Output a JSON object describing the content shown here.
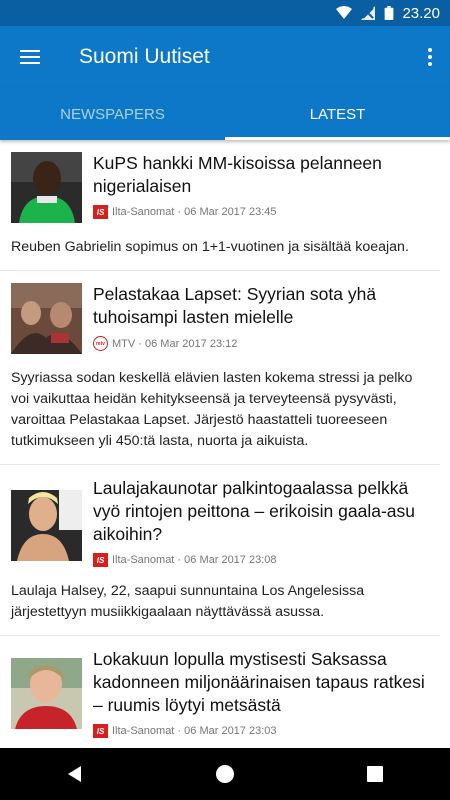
{
  "statusbar": {
    "time": "23.20"
  },
  "appbar": {
    "title": "Suomi Uutiset"
  },
  "tabs": [
    {
      "label": "NEWSPAPERS",
      "active": false
    },
    {
      "label": "LATEST",
      "active": true
    }
  ],
  "articles": [
    {
      "headline": "KuPS hankki MM-kisoissa pelanneen nigerialaisen",
      "source": "Ilta-Sanomat",
      "date": "06 Mar 2017 23:45",
      "summary": "Reuben Gabrielin sopimus on 1+1-vuotinen ja sisältää koeajan.",
      "source_icon": "is-logo-icon"
    },
    {
      "headline": "Pelastakaa Lapset: Syyrian sota yhä tuhoisampi lasten mielelle",
      "source": "MTV",
      "date": "06 Mar 2017 23:12",
      "summary": "Syyriassa sodan keskellä elävien lasten kokema stressi ja pelko voi vaikuttaa heidän kehitykseensä ja terveyteensä pysyvästi, varoittaa Pelastakaa Lapset. Järjestö haastatteli tuoreeseen tutkimukseen yli 450:tä lasta, nuorta ja aikuista.",
      "source_icon": "mtv-logo-icon"
    },
    {
      "headline": "Laulajakaunotar palkintogaalassa pelkkä vyö rintojen peittona – erikoisin gaala-asu aikoihin?",
      "source": "Ilta-Sanomat",
      "date": "06 Mar 2017 23:08",
      "summary": "Laulaja Halsey, 22, saapui sunnuntaina Los Angelesissa järjestettyyn musiikkigaalaan näyttävässä asussa.",
      "source_icon": "is-logo-icon"
    },
    {
      "headline": "Lokakuun lopulla mystisesti Saksassa kadonneen miljonäärinaisen tapaus ratkesi – ruumis löytyi metsästä",
      "source": "Ilta-Sanomat",
      "date": "06 Mar 2017 23:03",
      "summary": "",
      "source_icon": "is-logo-icon"
    }
  ],
  "source_logos": {
    "is": "IS",
    "mtv": "mtv"
  },
  "colors": {
    "appbar": "#0d78c8",
    "statusbar": "#0a5fa3",
    "brand_red": "#d7201e"
  }
}
